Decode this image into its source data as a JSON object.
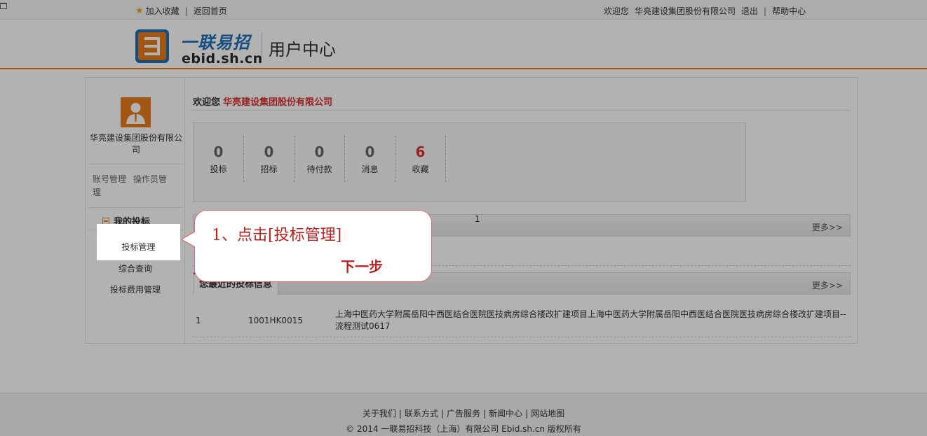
{
  "topbar": {
    "favorite": "加入收藏",
    "home": "返回首页",
    "welcome": "欢迎您",
    "company": "华亮建设集团股份有限公司",
    "logout": "退出",
    "help": "帮助中心",
    "separator": "|"
  },
  "header": {
    "logo_cn": "一联易招",
    "logo_en": "ebid.sh.cn",
    "subtitle": "用户中心"
  },
  "sidebar": {
    "company_name": "华亮建设集团股份有限公司",
    "account_mgmt": "账号管理",
    "operator_mgmt": "操作员管理",
    "section_title": "我的投标",
    "menu": [
      "投标管理",
      "综合查询",
      "投标费用管理"
    ]
  },
  "content": {
    "welcome_prefix": "欢迎您",
    "welcome_company": "华亮建设集团股份有限公司",
    "stats": [
      {
        "value": "0",
        "label": "投标"
      },
      {
        "value": "0",
        "label": "招标"
      },
      {
        "value": "0",
        "label": "待付款"
      },
      {
        "value": "0",
        "label": "消息"
      },
      {
        "value": "6",
        "label": "收藏"
      }
    ],
    "section1": {
      "count": "1",
      "more": "更多>>"
    },
    "section2": {
      "title": "您最近的投标信息",
      "more": "更多>>"
    },
    "recent_rows": [
      {
        "index": "1",
        "code": "1001HK0015",
        "name": "上海中医药大学附属岳阳中西医结合医院医技病房综合楼改扩建项目上海中医药大学附属岳阳中西医结合医院医技病房综合楼改扩建项目--流程测试0617"
      }
    ]
  },
  "footer": {
    "links": [
      "关于我们",
      "联系方式",
      "广告服务",
      "新闻中心",
      "网站地图"
    ],
    "copyright": "© 2014 一联易招科技（上海）有限公司 Ebid.sh.cn 版权所有"
  },
  "tutorial": {
    "step_text": "1、点击[投标管理]",
    "next_text": "下一步"
  },
  "colors": {
    "accent": "#e87b1e",
    "brand_blue": "#1f6fb5",
    "highlight_red": "#d9302f"
  }
}
